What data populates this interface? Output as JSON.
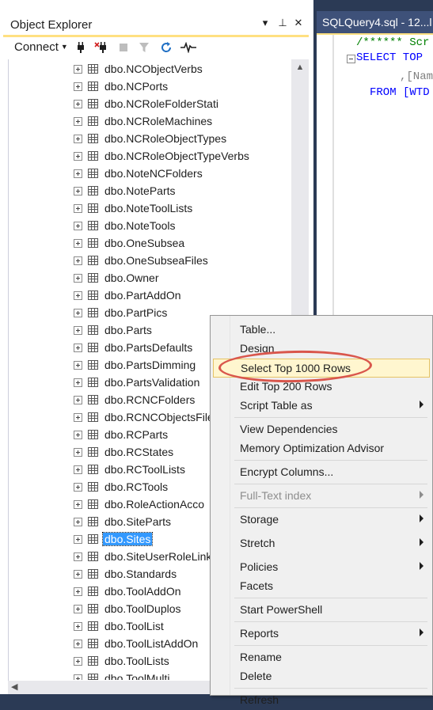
{
  "object_explorer": {
    "title": "Object Explorer",
    "title_buttons": {
      "dropdown": "▾",
      "pin": "⊥",
      "close": "✕"
    },
    "toolbar": {
      "connect_label": "Connect",
      "icons": [
        "connect-plug-icon",
        "disconnect-plug-icon",
        "stop-icon",
        "filter-icon",
        "refresh-icon",
        "activity-monitor-icon"
      ]
    },
    "tree_items": [
      "dbo.NCObjectVerbs",
      "dbo.NCPorts",
      "dbo.NCRoleFolderStati",
      "dbo.NCRoleMachines",
      "dbo.NCRoleObjectTypes",
      "dbo.NCRoleObjectTypeVerbs",
      "dbo.NoteNCFolders",
      "dbo.NoteParts",
      "dbo.NoteToolLists",
      "dbo.NoteTools",
      "dbo.OneSubsea",
      "dbo.OneSubseaFiles",
      "dbo.Owner",
      "dbo.PartAddOn",
      "dbo.PartPics",
      "dbo.Parts",
      "dbo.PartsDefaults",
      "dbo.PartsDimming",
      "dbo.PartsValidation",
      "dbo.RCNCFolders",
      "dbo.RCNCObjectsFile",
      "dbo.RCParts",
      "dbo.RCStates",
      "dbo.RCToolLists",
      "dbo.RCTools",
      "dbo.RoleActionAcco",
      "dbo.SiteParts",
      "dbo.Sites",
      "dbo.SiteUserRoleLink",
      "dbo.Standards",
      "dbo.ToolAddOn",
      "dbo.ToolDuplos",
      "dbo.ToolList",
      "dbo.ToolListAddOn",
      "dbo.ToolLists",
      "dbo.ToolMulti"
    ],
    "selected_item": "dbo.Sites"
  },
  "editor": {
    "tab_title": "SQLQuery4.sql - 12...l",
    "lines": [
      {
        "text": "/****** Scr",
        "color": "#008000"
      },
      {
        "text": "SELECT TOP",
        "color": "#0000ff"
      },
      {
        "text": ",[Nam",
        "color": "#808080"
      },
      {
        "text": "FROM [WTD",
        "color": "#0000ff"
      }
    ]
  },
  "context_menu": {
    "items": [
      {
        "label": "Table...",
        "submenu": false,
        "disabled": false
      },
      {
        "label": "Design",
        "submenu": false,
        "disabled": false
      },
      {
        "label": "Select Top 1000 Rows",
        "submenu": false,
        "disabled": false,
        "highlighted": true
      },
      {
        "label": "Edit Top 200 Rows",
        "submenu": false,
        "disabled": false
      },
      {
        "label": "Script Table as",
        "submenu": true,
        "disabled": false
      },
      {
        "label": "View Dependencies",
        "submenu": false,
        "disabled": false
      },
      {
        "label": "Memory Optimization Advisor",
        "submenu": false,
        "disabled": false
      },
      {
        "label": "Encrypt Columns...",
        "submenu": false,
        "disabled": false
      },
      {
        "label": "Full-Text index",
        "submenu": true,
        "disabled": true
      },
      {
        "label": "Storage",
        "submenu": true,
        "disabled": false
      },
      {
        "label": "Stretch",
        "submenu": true,
        "disabled": false
      },
      {
        "label": "Policies",
        "submenu": true,
        "disabled": false
      },
      {
        "label": "Facets",
        "submenu": false,
        "disabled": false
      },
      {
        "label": "Start PowerShell",
        "submenu": false,
        "disabled": false
      },
      {
        "label": "Reports",
        "submenu": true,
        "disabled": false
      },
      {
        "label": "Rename",
        "submenu": false,
        "disabled": false
      },
      {
        "label": "Delete",
        "submenu": false,
        "disabled": false
      },
      {
        "label": "Refresh",
        "submenu": false,
        "disabled": false
      }
    ]
  },
  "colors": {
    "selection": "#3399ff",
    "highlight_annotation": "#d9564c",
    "tab_active": "#3e5179",
    "accent_bar": "#ffe081"
  }
}
